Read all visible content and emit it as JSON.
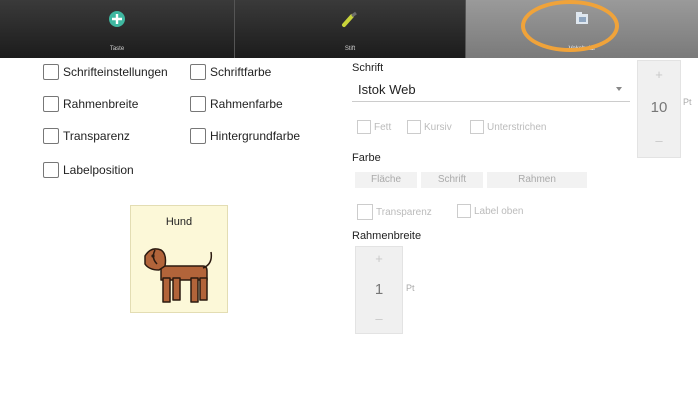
{
  "tabs": [
    {
      "label": "Taste",
      "icon": "add-circle-icon",
      "active": false
    },
    {
      "label": "Stift",
      "icon": "brush-icon",
      "active": false
    },
    {
      "label": "Vokabular",
      "icon": "folder-icon",
      "active": true
    }
  ],
  "checkboxes": {
    "schrifteinstellungen": "Schrifteinstellungen",
    "schriftfarbe": "Schriftfarbe",
    "rahmenbreite": "Rahmenbreite",
    "rahmenfarbe": "Rahmenfarbe",
    "transparenz": "Transparenz",
    "hintergrundfarbe": "Hintergrundfarbe",
    "labelposition": "Labelposition"
  },
  "card": {
    "label": "Hund",
    "icon": "dog-icon"
  },
  "schrift": {
    "heading": "Schrift",
    "font_value": "Istok Web",
    "size_value": "10",
    "size_unit": "Pt",
    "plus": "+",
    "minus": "–",
    "styles": [
      "Fett",
      "Kursiv",
      "Unterstrichen"
    ]
  },
  "farbe": {
    "heading": "Farbe",
    "buttons": [
      "Fläche",
      "Schrift",
      "Rahmen"
    ],
    "transparenz": "Transparenz",
    "label_oben": "Label oben"
  },
  "rahmenbreite": {
    "heading": "Rahmenbreite",
    "value": "1",
    "unit": "Pt",
    "plus": "+",
    "minus": "–"
  },
  "colors": {
    "accent_ring": "#f0a33a",
    "card_bg": "#fcf8d8",
    "dog": "#b2643a"
  }
}
